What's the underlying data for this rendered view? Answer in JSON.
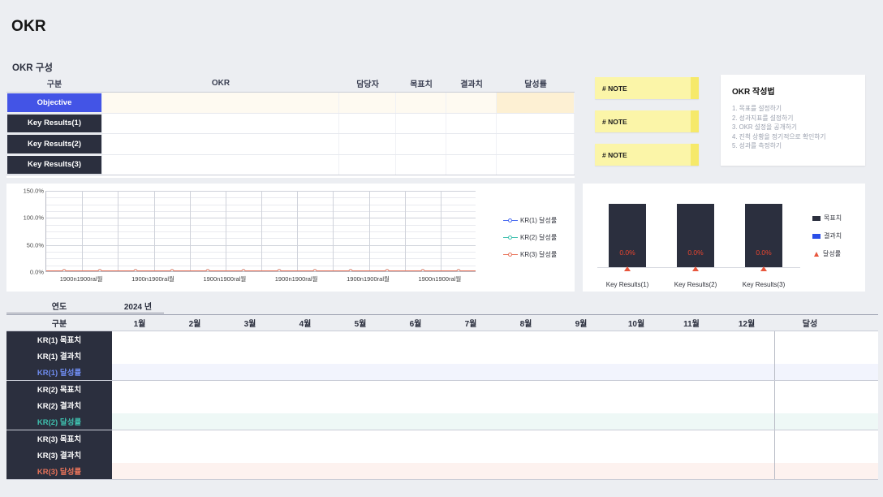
{
  "page": {
    "title": "OKR",
    "section_label": "OKR 구성"
  },
  "okr_table": {
    "headers": [
      "구분",
      "OKR",
      "담당자",
      "목표치",
      "결과치",
      "달성률"
    ],
    "rows": [
      {
        "label": "Objective",
        "type": "objective",
        "okr": "",
        "owner": "",
        "target": "",
        "result": "",
        "rate": ""
      },
      {
        "label": "Key Results(1)",
        "type": "kr",
        "okr": "",
        "owner": "",
        "target": "",
        "result": "",
        "rate": ""
      },
      {
        "label": "Key Results(2)",
        "type": "kr",
        "okr": "",
        "owner": "",
        "target": "",
        "result": "",
        "rate": ""
      },
      {
        "label": "Key Results(3)",
        "type": "kr",
        "okr": "",
        "owner": "",
        "target": "",
        "result": "",
        "rate": ""
      }
    ]
  },
  "notes": [
    {
      "label": "# NOTE"
    },
    {
      "label": "# NOTE"
    },
    {
      "label": "# NOTE"
    }
  ],
  "guide": {
    "title": "OKR 작성법",
    "items": [
      "1. 목표를 설정하기",
      "2. 성과지표를 설정하기",
      "3. OKR 설정을 공개하기",
      "4. 진척 상황을 정기적으로 확인하기",
      "5. 성과를 측정하기"
    ]
  },
  "colors": {
    "objective": "#4354e6",
    "dark": "#2b2f3e",
    "kr1": "#4a6cf0",
    "kr2": "#3fc0ae",
    "kr3": "#e8735a",
    "note": "#fbf5a8",
    "background": "#eceef2"
  },
  "chart_data": [
    {
      "type": "line",
      "title": "",
      "xlabel": "",
      "ylabel": "",
      "ylim": [
        0,
        150
      ],
      "yticks": [
        "0.0%",
        "50.0%",
        "100.0%",
        "150.0%"
      ],
      "ytick_values": [
        0,
        50,
        100,
        150
      ],
      "grid": true,
      "legend_position": "right",
      "x": [
        "1900n1900ral월",
        "1900n1900ral월",
        "1900n1900ral월",
        "1900n1900ral월",
        "1900n1900ral월",
        "1900n1900ral월",
        "1900n1900ral월",
        "1900n1900ral월",
        "1900n1900ral월",
        "1900n1900ral월",
        "1900n1900ral월",
        "1900n1900ral월"
      ],
      "xtick_labels": [
        "1900n1900ral월",
        "1900n1900ral월",
        "1900n1900ral월",
        "1900n1900ral월",
        "1900n1900ral월",
        "1900n1900ral월"
      ],
      "series": [
        {
          "name": "KR(1) 달성률",
          "color": "#4a6cf0",
          "values": [
            0,
            0,
            0,
            0,
            0,
            0,
            0,
            0,
            0,
            0,
            0,
            0
          ]
        },
        {
          "name": "KR(2) 달성률",
          "color": "#3fc0ae",
          "values": [
            0,
            0,
            0,
            0,
            0,
            0,
            0,
            0,
            0,
            0,
            0,
            0
          ]
        },
        {
          "name": "KR(3) 달성률",
          "color": "#e8735a",
          "values": [
            0,
            0,
            0,
            0,
            0,
            0,
            0,
            0,
            0,
            0,
            0,
            0
          ]
        }
      ]
    },
    {
      "type": "bar",
      "title": "",
      "xlabel": "",
      "ylabel": "",
      "categories": [
        "Key Results(1)",
        "Key Results(2)",
        "Key Results(3)"
      ],
      "data_labels": [
        "0.0%",
        "0.0%",
        "0.0%"
      ],
      "grid": false,
      "legend_position": "right",
      "series": [
        {
          "name": "목표치",
          "color": "#2b2f3e",
          "values": [
            100,
            100,
            100
          ]
        },
        {
          "name": "결과치",
          "color": "#2b4fe8",
          "values": [
            0,
            0,
            0
          ]
        },
        {
          "name": "달성률",
          "color": "#e8563c",
          "values": [
            0,
            0,
            0
          ]
        }
      ]
    }
  ],
  "month_table": {
    "year_label": "연도",
    "year_value": "2024 년",
    "first_header": "구분",
    "months": [
      "1월",
      "2월",
      "3월",
      "4월",
      "5월",
      "6월",
      "7월",
      "8월",
      "9월",
      "10월",
      "11월",
      "12월"
    ],
    "total_header": "달성",
    "groups": [
      {
        "rows": [
          {
            "label": "KR(1) 목표치",
            "style": "plain",
            "values": [
              "",
              "",
              "",
              "",
              "",
              "",
              "",
              "",
              "",
              "",
              "",
              ""
            ],
            "total": ""
          },
          {
            "label": "KR(1) 결과치",
            "style": "plain",
            "values": [
              "",
              "",
              "",
              "",
              "",
              "",
              "",
              "",
              "",
              "",
              "",
              ""
            ],
            "total": ""
          },
          {
            "label": "KR(1) 달성률",
            "style": "rate1",
            "values": [
              "",
              "",
              "",
              "",
              "",
              "",
              "",
              "",
              "",
              "",
              "",
              ""
            ],
            "total": ""
          }
        ]
      },
      {
        "rows": [
          {
            "label": "KR(2) 목표치",
            "style": "plain",
            "values": [
              "",
              "",
              "",
              "",
              "",
              "",
              "",
              "",
              "",
              "",
              "",
              ""
            ],
            "total": ""
          },
          {
            "label": "KR(2) 결과치",
            "style": "plain",
            "values": [
              "",
              "",
              "",
              "",
              "",
              "",
              "",
              "",
              "",
              "",
              "",
              ""
            ],
            "total": ""
          },
          {
            "label": "KR(2) 달성률",
            "style": "rate2",
            "values": [
              "",
              "",
              "",
              "",
              "",
              "",
              "",
              "",
              "",
              "",
              "",
              ""
            ],
            "total": ""
          }
        ]
      },
      {
        "rows": [
          {
            "label": "KR(3) 목표치",
            "style": "plain",
            "values": [
              "",
              "",
              "",
              "",
              "",
              "",
              "",
              "",
              "",
              "",
              "",
              ""
            ],
            "total": ""
          },
          {
            "label": "KR(3) 결과치",
            "style": "plain",
            "values": [
              "",
              "",
              "",
              "",
              "",
              "",
              "",
              "",
              "",
              "",
              "",
              ""
            ],
            "total": ""
          },
          {
            "label": "KR(3) 달성률",
            "style": "rate3",
            "values": [
              "",
              "",
              "",
              "",
              "",
              "",
              "",
              "",
              "",
              "",
              "",
              ""
            ],
            "total": ""
          }
        ]
      }
    ]
  }
}
